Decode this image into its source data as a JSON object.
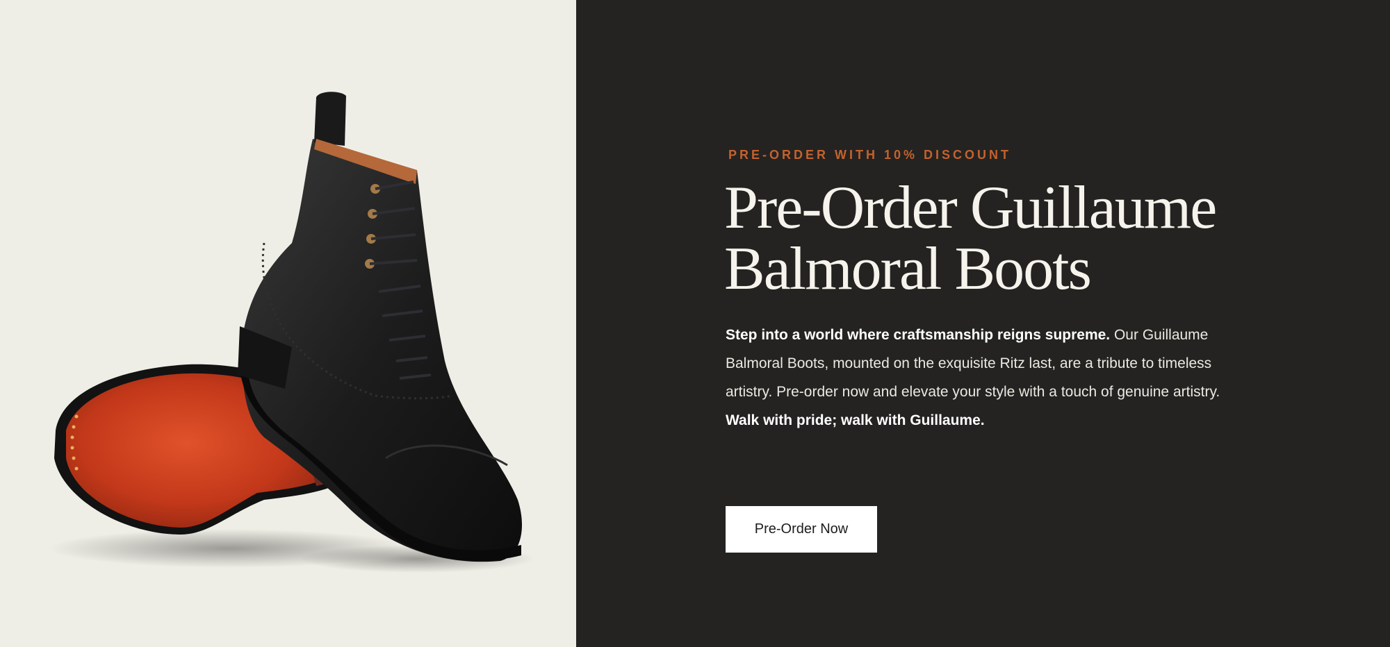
{
  "hero": {
    "eyebrow": "PRE-ORDER WITH 10% DISCOUNT",
    "headline_line1": "Pre-Order Guillaume",
    "headline_line2": "Balmoral Boots",
    "description": {
      "bold_intro": "Step into a world where craftsmanship reigns supreme.",
      "body": " Our Guillaume Balmoral Boots, mounted on the exquisite Ritz last, are a tribute to timeless artistry. Pre-order now and elevate your style with a touch of genuine artistry. ",
      "bold_outro": "Walk with pride; walk with Guillaume."
    },
    "cta_label": "Pre-Order Now"
  },
  "product_image": {
    "alt": "Black leather cap-toe balmoral boot with a second boot showing its orange leather sole",
    "icon": "boot-product-image"
  },
  "colors": {
    "image_bg": "#efeee6",
    "panel_bg": "#242322",
    "accent": "#c4622d",
    "button_bg": "#ffffff"
  }
}
